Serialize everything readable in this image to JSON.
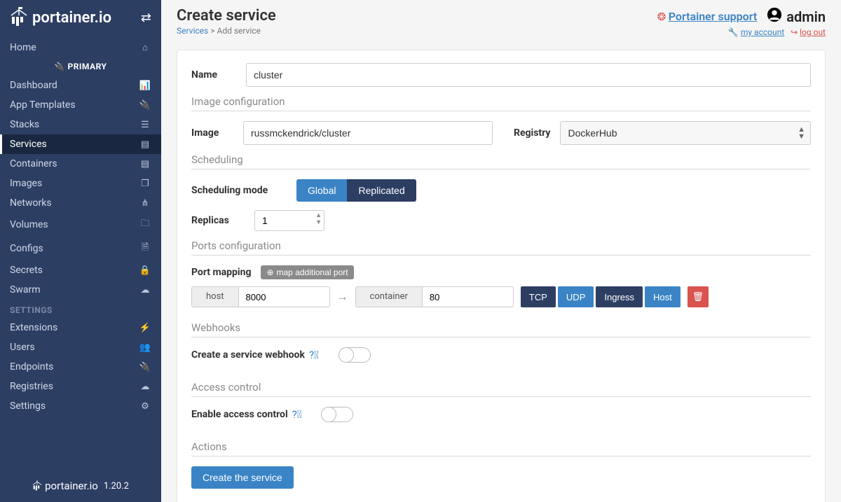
{
  "sidebar": {
    "logo": "portainer.io",
    "collapse_icon": "collapse-icon",
    "items": [
      {
        "label": "Home",
        "icon": "⌂"
      },
      {
        "label": "PRIMARY",
        "primary": true
      },
      {
        "label": "Dashboard",
        "icon": "📊"
      },
      {
        "label": "App Templates",
        "icon": "🔌"
      },
      {
        "label": "Stacks",
        "icon": "☰"
      },
      {
        "label": "Services",
        "icon": "▤",
        "active": true
      },
      {
        "label": "Containers",
        "icon": "▤"
      },
      {
        "label": "Images",
        "icon": "❐"
      },
      {
        "label": "Networks",
        "icon": "⋔"
      },
      {
        "label": "Volumes",
        "icon": "🗀"
      },
      {
        "label": "Configs",
        "icon": "🗎"
      },
      {
        "label": "Secrets",
        "icon": "🔒"
      },
      {
        "label": "Swarm",
        "icon": "☁"
      }
    ],
    "settings_label": "SETTINGS",
    "settings": [
      {
        "label": "Extensions",
        "icon": "⚡"
      },
      {
        "label": "Users",
        "icon": "👥"
      },
      {
        "label": "Endpoints",
        "icon": "🔌"
      },
      {
        "label": "Registries",
        "icon": "☁"
      },
      {
        "label": "Settings",
        "icon": "⚙"
      }
    ],
    "footer": {
      "logo": "portainer.io",
      "version": "1.20.2"
    }
  },
  "header": {
    "title": "Create service",
    "breadcrumb": {
      "link": "Services",
      "sep": ">",
      "current": "Add service"
    },
    "support": "Portainer support",
    "admin": "admin",
    "my_account": "my account",
    "logout": "log out"
  },
  "form": {
    "name_label": "Name",
    "name_value": "cluster",
    "section_image": "Image configuration",
    "image_label": "Image",
    "image_value": "russmckendrick/cluster",
    "registry_label": "Registry",
    "registry_value": "DockerHub",
    "section_sched": "Scheduling",
    "sched_mode_label": "Scheduling mode",
    "sched_global": "Global",
    "sched_replicated": "Replicated",
    "replicas_label": "Replicas",
    "replicas_value": "1",
    "section_ports": "Ports configuration",
    "port_mapping_label": "Port mapping",
    "map_additional": "map additional port",
    "host_label": "host",
    "host_value": "8000",
    "container_label": "container",
    "container_value": "80",
    "proto_tcp": "TCP",
    "proto_udp": "UDP",
    "proto_ingress": "Ingress",
    "proto_host": "Host",
    "section_webhooks": "Webhooks",
    "webhook_label": "Create a service webhook",
    "section_access": "Access control",
    "access_label": "Enable access control",
    "section_actions": "Actions",
    "create_btn": "Create the service"
  }
}
